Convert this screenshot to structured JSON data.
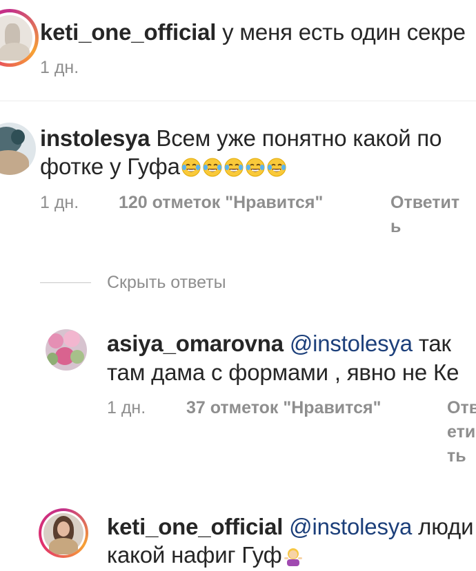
{
  "comments": [
    {
      "username": "keti_one_official",
      "text": "у меня есть один секре",
      "time": "1 дн."
    },
    {
      "username": "instolesya",
      "text_line1": "Всем уже понятно какой по",
      "text_line2": "фотке у Гуфа",
      "emojis": [
        "joy-emoji",
        "joy-emoji",
        "joy-emoji",
        "joy-emoji",
        "joy-emoji"
      ],
      "time": "1 дн.",
      "likes": "120 отметок \"Нравится\"",
      "reply_line1": "Ответит",
      "reply_line2": "ь"
    }
  ],
  "hide_replies": "Скрыть ответы",
  "replies": [
    {
      "username": "asiya_omarovna",
      "mention": "@instolesya",
      "text_line1": "так",
      "text_line2": "там дама с формами , явно не Ке",
      "time": "1 дн.",
      "likes": "37 отметок \"Нравится\"",
      "reply_line1": "Отв",
      "reply_line2": "ети",
      "reply_line3": "ть"
    },
    {
      "username": "keti_one_official",
      "mention": "@instolesya",
      "text_line1": "люди",
      "text_line2": "какой нафиг Гуф",
      "emoji": "woman-shrugging-emoji"
    }
  ],
  "colors": {
    "text": "#262626",
    "muted": "#8e8e8e",
    "mention": "#1c3f7a",
    "story_ring_start": "#f7a234",
    "story_ring_end": "#c2308a"
  }
}
